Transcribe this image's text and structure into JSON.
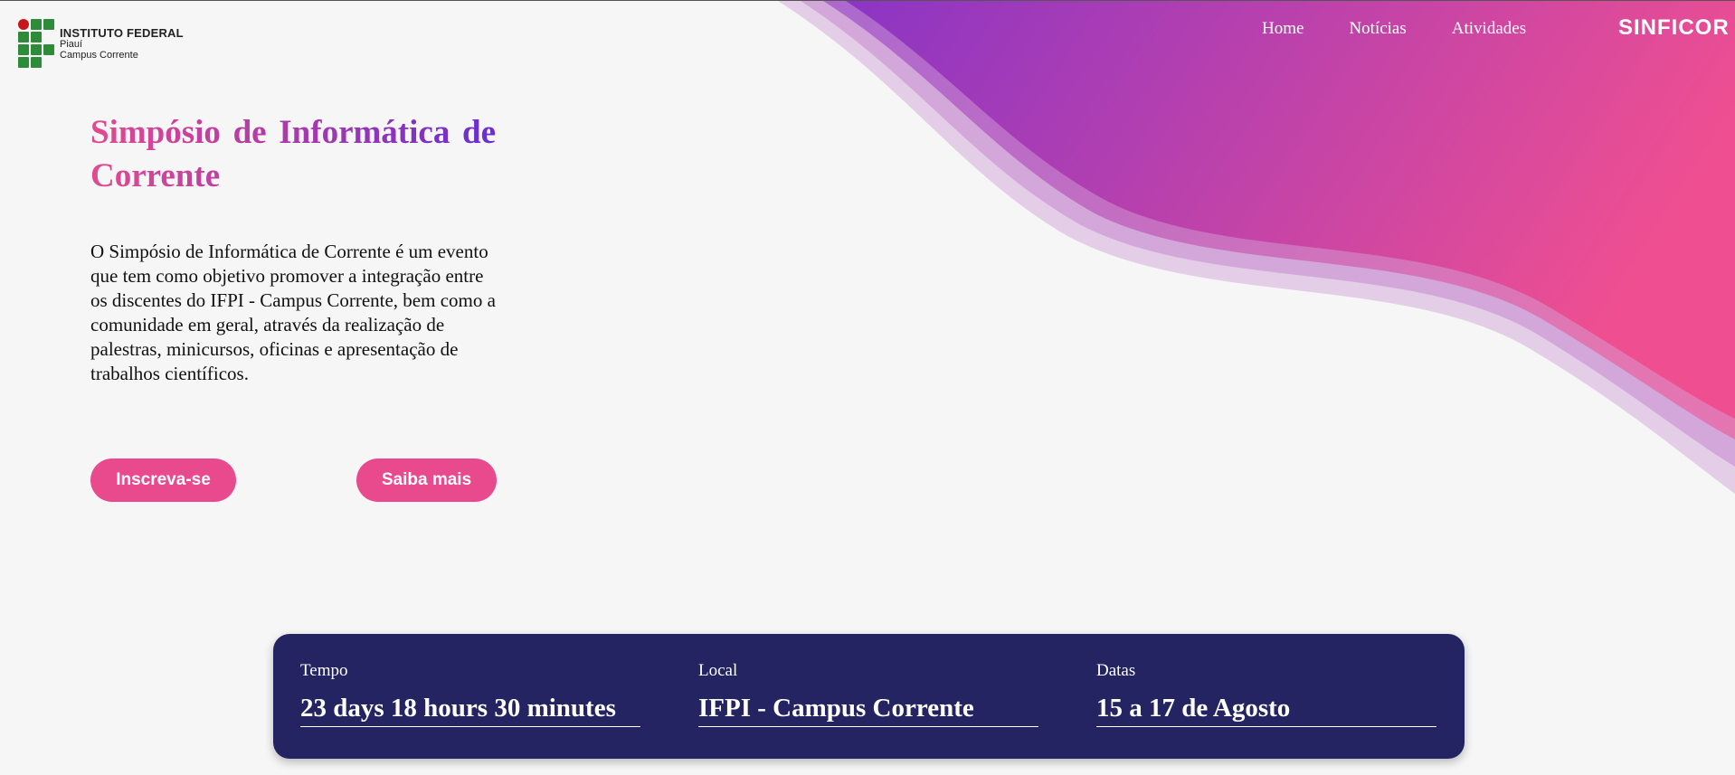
{
  "header": {
    "logo": {
      "name": "INSTITUTO FEDERAL",
      "state": "Piauí",
      "campus": "Campus Corrente"
    },
    "nav": [
      "Home",
      "Notícias",
      "Atividades"
    ],
    "brand": "SINFICOR"
  },
  "hero": {
    "title": "Simpósio de Informática de Corrente",
    "description": "O Simpósio de Informática de Corrente é um evento que tem como objetivo promover a integração entre os discentes do IFPI - Campus Corrente, bem como a comunidade em geral, através da realização de palestras, minicursos, oficinas e apresentação de trabalhos científicos.",
    "primary_button": "Inscreva-se",
    "secondary_button": "Saiba mais"
  },
  "info": [
    {
      "label": "Tempo",
      "value": "23 days 18 hours 30 minutes"
    },
    {
      "label": "Local",
      "value": "IFPI - Campus Corrente"
    },
    {
      "label": "Datas",
      "value": "15 a 17 de Agosto"
    }
  ],
  "colors": {
    "accent_pink": "#e94a8e",
    "accent_purple": "#8b35c4",
    "panel": "#242463",
    "background": "#f6f6f6",
    "logo_green": "#2e8b3a",
    "logo_red": "#c8151d"
  }
}
